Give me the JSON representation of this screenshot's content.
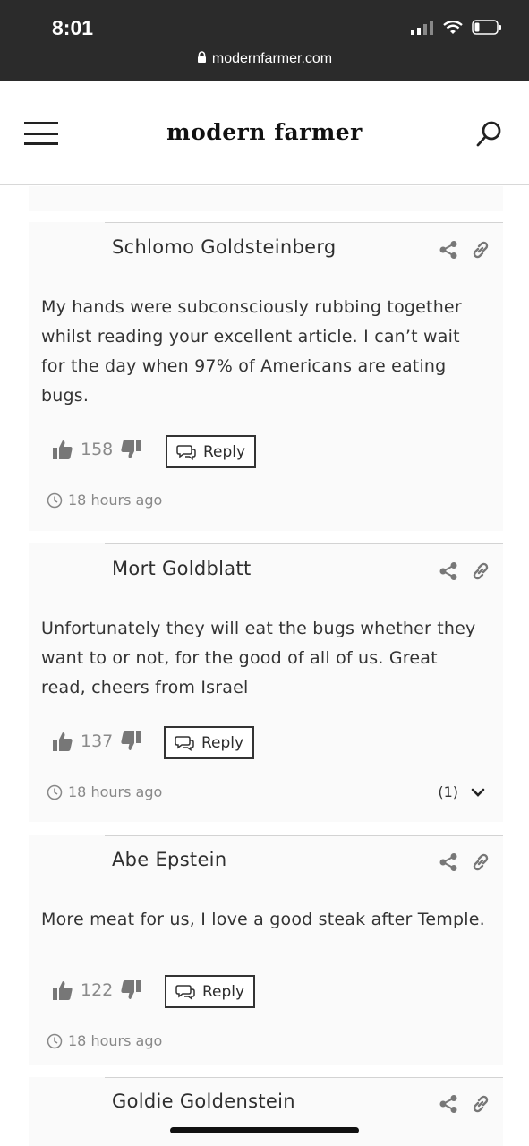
{
  "status_bar": {
    "time": "8:01",
    "url": "modernfarmer.com"
  },
  "header": {
    "logo": "modern farmer"
  },
  "comments": [
    {
      "author": "Schlomo Goldsteinberg",
      "lines": [
        "My hands were subconsciously rubbing together",
        "whilst reading your excellent article. I can’t wait",
        "for the day when 97% of Americans are eating",
        "bugs."
      ],
      "likes": "158",
      "reply_label": "Reply",
      "time": "18 hours ago"
    },
    {
      "author": "Mort Goldblatt",
      "lines": [
        "Unfortunately they will eat the bugs whether they",
        "want to or not, for the good of all of us. Great",
        "read, cheers from Israel"
      ],
      "likes": "137",
      "reply_label": "Reply",
      "time": "18 hours ago",
      "replies_count": "(1)"
    },
    {
      "author": "Abe Epstein",
      "lines": [
        "More meat for us, I love a good steak after Temple."
      ],
      "likes": "122",
      "reply_label": "Reply",
      "time": "18 hours ago"
    },
    {
      "author": "Goldie Goldenstein"
    }
  ]
}
